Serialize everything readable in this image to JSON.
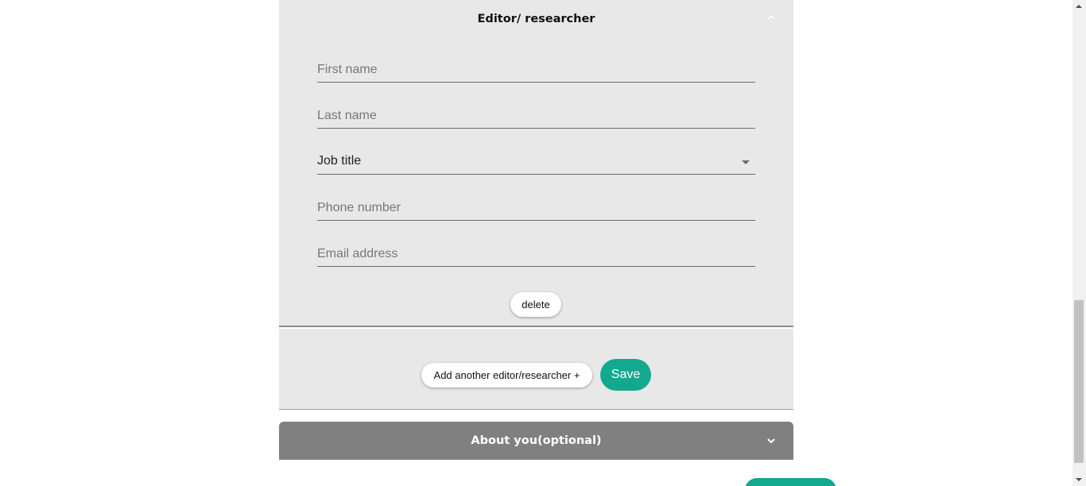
{
  "editor_panel": {
    "title": "Editor/ researcher",
    "collapse_icon": "chevron-up-icon",
    "fields": {
      "first_name_placeholder": "First name",
      "last_name_placeholder": "Last name",
      "job_title_value": "Job title",
      "phone_placeholder": "Phone number",
      "email_placeholder": "Email address"
    },
    "delete_label": "delete"
  },
  "actions": {
    "add_label": "Add another editor/researcher +",
    "save_label": "Save"
  },
  "about_section": {
    "title": "About you(optional)",
    "expand_icon": "chevron-down-icon"
  },
  "colors": {
    "accent": "#13a98e",
    "panel_bg": "#e8e8e8",
    "collapsed_header_bg": "#808080"
  }
}
